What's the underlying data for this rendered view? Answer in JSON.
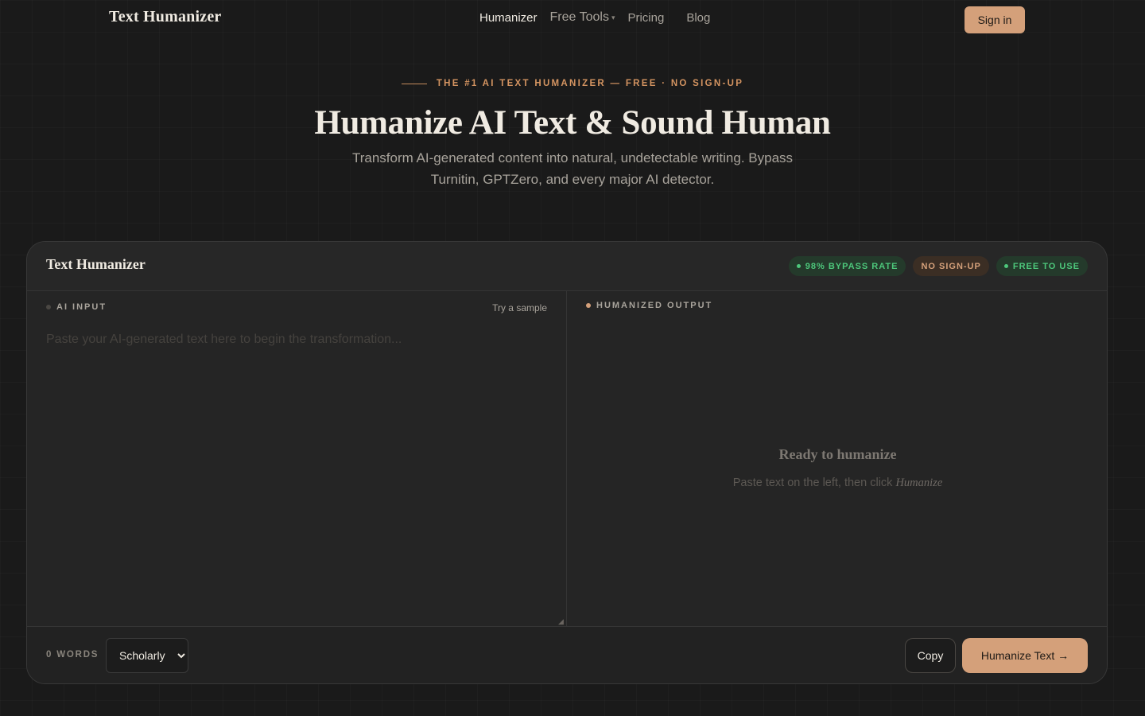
{
  "nav": {
    "logo": "Text Humanizer",
    "links": {
      "humanizer": "Humanizer",
      "free_tools": "Free Tools",
      "pricing": "Pricing",
      "blog": "Blog"
    },
    "signin": "Sign in"
  },
  "hero": {
    "eyebrow": "THE #1 AI TEXT HUMANIZER — FREE · NO SIGN-UP",
    "title": "Humanize AI Text & Sound Human",
    "subtitle": "Transform AI-generated content into natural, undetectable writing. Bypass Turnitin, GPTZero, and every major AI detector."
  },
  "card": {
    "title": "Text Humanizer",
    "badges": {
      "bypass": "98% BYPASS RATE",
      "signup": "NO SIGN-UP",
      "free": "FREE TO USE"
    },
    "input": {
      "label": "AI INPUT",
      "try_sample": "Try a sample",
      "placeholder": "Paste your AI-generated text here to begin the transformation..."
    },
    "output": {
      "label": "HUMANIZED OUTPUT",
      "ready_title": "Ready to humanize",
      "ready_sub": "Paste text on the left, then click",
      "ready_sub_emph": "Humanize"
    },
    "footer": {
      "word_count": "0 WORDS",
      "style_selected": "Scholarly",
      "copy": "Copy",
      "humanize": "Humanize Text →"
    }
  },
  "colors": {
    "accent": "#d4a07a",
    "green": "#4dc77b",
    "background": "#1a1a1a"
  },
  "icons": [
    "caret-down-icon",
    "status-dot-icon",
    "resize-grip-icon",
    "arrow-right-icon"
  ]
}
